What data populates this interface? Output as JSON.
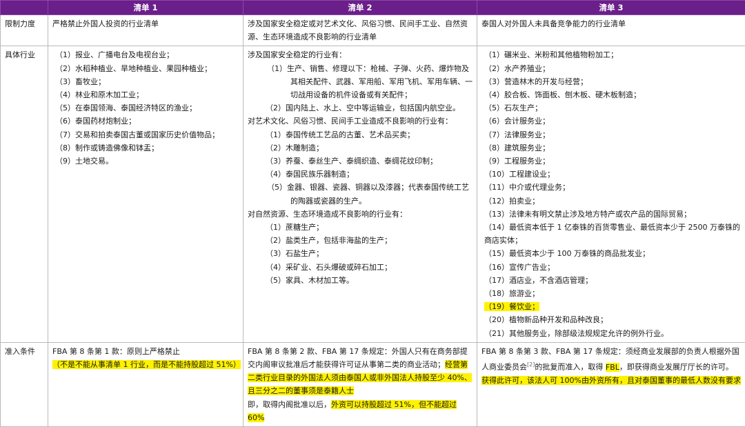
{
  "header": {
    "col0": "",
    "col1": "清单 1",
    "col2": "清单 2",
    "col3": "清单 3"
  },
  "rows": {
    "limit": {
      "label": "限制力度",
      "c1": "严格禁止外国人投资的行业清单",
      "c2": "涉及国家安全稳定或对艺术文化、风俗习惯、民间手工业、自然资源、生态环境造成不良影响的行业清单",
      "c3": "泰国人对外国人未具备竞争能力的行业清单"
    },
    "industry": {
      "label": "具体行业",
      "c1": [
        "（1）报业、广播电台及电视台业；",
        "（2）水稻种植业、旱地种植业、果园种植业；",
        "（3）畜牧业；",
        "（4）林业和原木加工业；",
        "（5）在泰国领海、泰国经济特区的渔业；",
        "（6）泰国药材炮制业；",
        "（7）交易和拍卖泰国古董或国家历史价值物品；",
        "（8）制作或铸造佛像和钵盂；",
        "（9）土地交易。"
      ],
      "c2": {
        "g1_head": "涉及国家安全稳定的行业有：",
        "g1_items": [
          "（1）生产、销售、修理以下：枪械、子弹、火药、爆炸物及其相关配件、武器、军用船、军用飞机、军用车辆、一切战用设备的机件设备或有关配件；",
          "（2）国内陆上、水上、空中等运输业，包括国内航空业。"
        ],
        "g2_head": "对艺术文化、风俗习惯、民间手工业造成不良影响的行业有：",
        "g2_items": [
          "（1）泰国传统工艺品的古董、艺术品买卖；",
          "（2）木雕制造；",
          "（3）养蚕、泰丝生产、泰绸织造、泰绸花纹印制；",
          "（4）泰国民族乐器制造；",
          "（5）金器、银器、瓷器、铜器以及漆器；代表泰国传统工艺的陶器或瓷器的生产。"
        ],
        "g3_head": "对自然资源、生态环境造成不良影响的行业有：",
        "g3_items": [
          "（1）蔗糖生产；",
          "（2）盐类生产，包括非海盐的生产；",
          "（3）石盐生产；",
          "（4）采矿业、石头爆破或碎石加工；",
          "（5）家具、木材加工等。"
        ]
      },
      "c3": [
        "（1）碾米业、米粉和其他植物粉加工；",
        "（2）水产养殖业；",
        "（3）营造林木的开发与经营；",
        "（4）胶合板、饰面板、刨木板、硬木板制造；",
        "（5）石灰生产；",
        "（6）会计服务业；",
        "（7）法律服务业；",
        "（8）建筑服务业；",
        "（9）工程服务业；",
        "（10）工程建设业；",
        "（11）中介或代理业务；",
        "（12）拍卖业；",
        "（13）法律未有明文禁止涉及地方特产或农产品的国际贸易；",
        "（14）最低资本低于 1 亿泰铢的百货零售业、最低资本少于 2500 万泰铢的商店实体；",
        "（15）最低资本少于 100 万泰铢的商品批发业；",
        "（16）宣传广告业；",
        "（17）酒店业，不含酒店管理；",
        "（18）旅游业；",
        "（19）餐饮业；",
        "（20）植物新品种开发和品种改良；",
        "（21）其他服务业，除部级法规规定允许的例外行业。"
      ]
    },
    "entry": {
      "label": "准入条件",
      "c1_line1": "FBA 第 8 条第 1 款：原则上严格禁止",
      "c1_line2": "（不是不能从事清单 1 行业，而是不能持股超过 51%）",
      "c2_part1": "FBA 第 8 条第 2 款、FBA 第 17 条规定：外国人只有在商务部提交内阁审议批准后才能获得许可证从事第二类的商业活动；",
      "c2_part2": "经营第二类行业目录的外国法人须由泰国人或非外国法人持股至少 40%、且三分之二的董事须是泰籍人士",
      "c2_part3": "即，取得内阁批准以后，",
      "c2_part4": "外资可以持股超过 51%，但不能超过 60%",
      "c3_part1": "FBA 第 8 条第 3 款、FBA 第 17 条规定：须经商业发展部的负责人根据外国人商业委员会",
      "c3_ref": "[2]",
      "c3_part2": "的批复而准入，取得 ",
      "c3_fbl": "FBL",
      "c3_part3": "，即获得商业发展厅厅长的许可。",
      "c3_part4": "获得此许可，该法人可 100%由外资所有，且对泰国董事的最低人数没有要求"
    }
  }
}
